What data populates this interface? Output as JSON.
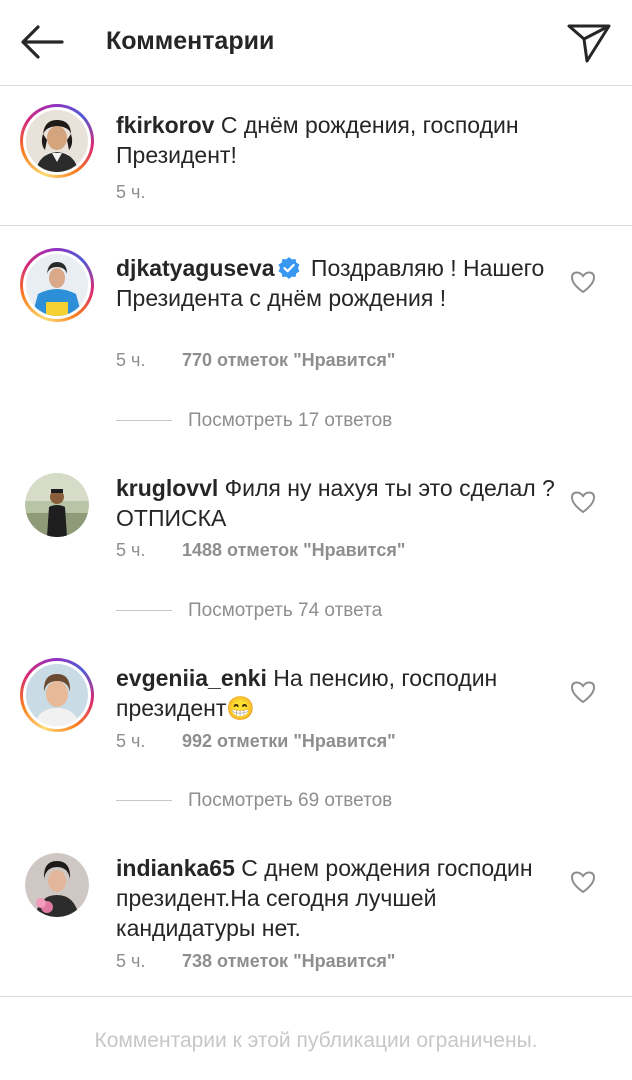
{
  "header": {
    "title": "Комментарии",
    "back_icon": "arrow-left-icon",
    "send_icon": "paper-plane-icon"
  },
  "caption": {
    "username": "fkirkorov",
    "text": "С днём рождения, господин Президент!",
    "time": "5 ч."
  },
  "comments": [
    {
      "username": "djkatyaguseva",
      "verified": true,
      "text": "Поздравляю ! Нашего Президента с днём рождения !",
      "time": "5 ч.",
      "likes": "770 отметок \"Нравится\"",
      "replies": "Посмотреть 17 ответов"
    },
    {
      "username": "kruglovvl",
      "verified": false,
      "text": "Филя ну нахуя ты это сделал ? ОТПИСКА",
      "time": "5 ч.",
      "likes": "1488 отметок \"Нравится\"",
      "replies": "Посмотреть 74 ответа"
    },
    {
      "username": "evgeniia_enki",
      "verified": false,
      "text": "На пенсию, господин президент😁",
      "time": "5 ч.",
      "likes": "992 отметки \"Нравится\"",
      "replies": "Посмотреть 69 ответов"
    },
    {
      "username": "indianka65",
      "verified": false,
      "text": "С днем рождения господин президент.На сегодня лучшей кандидатуры нет.",
      "time": "5 ч.",
      "likes": "738 отметок \"Нравится\""
    }
  ],
  "footer": {
    "notice": "Комментарии к этой публикации ограничены."
  },
  "colors": {
    "text": "#262626",
    "secondary": "#8e8e8e",
    "divider": "#dbdbdb",
    "verified": "#3897f0"
  }
}
